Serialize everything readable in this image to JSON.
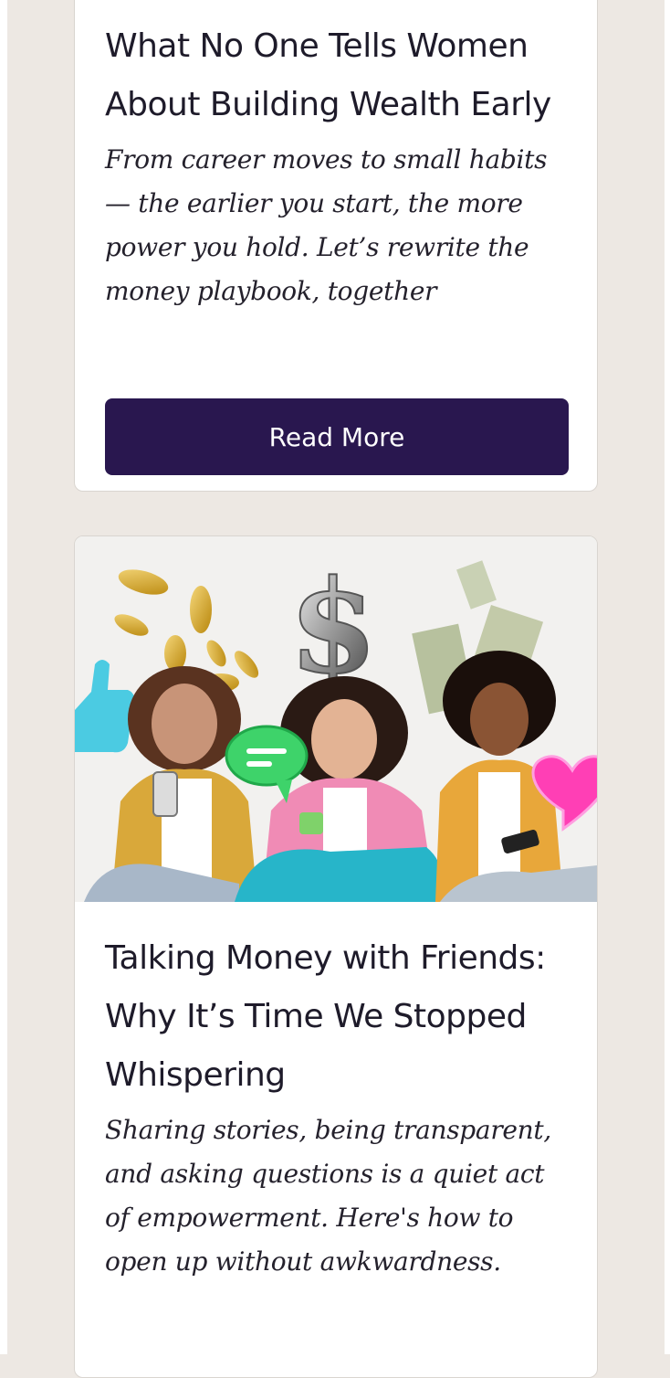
{
  "posts": [
    {
      "title": "What No One Tells Women About Building Wealth Early",
      "excerpt": "From career moves to small habits — the earlier you start, the more power you hold. Let’s rewrite the money playbook, together",
      "cta": "Read More"
    },
    {
      "title": "Talking Money with Friends: Why It’s Time We Stopped Whispering",
      "excerpt": "Sharing stories, being transparent, and asking questions is a quiet act of empowerment. Here's how to open up without awkwardness.",
      "image_icons": [
        "dollar-sign-icon",
        "coin-icon",
        "banknote-icon",
        "thumbs-up-icon",
        "chat-bubble-icon",
        "heart-icon"
      ]
    }
  ],
  "colors": {
    "page_background": "#ede8e3",
    "card_background": "#ffffff",
    "button_background": "#29174f",
    "button_text": "#ffffff",
    "text": "#1e1b2a"
  }
}
